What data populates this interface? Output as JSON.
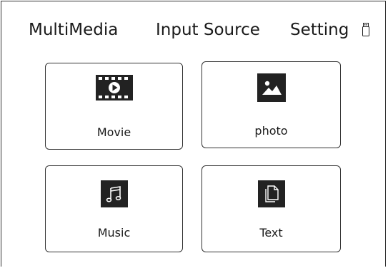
{
  "menu": {
    "multimedia": "MultiMedia",
    "input_source": "Input Source",
    "setting": "Setting"
  },
  "status": {
    "icon": "usb-drive-icon"
  },
  "tiles": [
    {
      "label": "Movie",
      "icon": "film-icon"
    },
    {
      "label": "photo",
      "icon": "image-icon"
    },
    {
      "label": "Music",
      "icon": "music-note-icon"
    },
    {
      "label": "Text",
      "icon": "document-icon"
    }
  ],
  "colors": {
    "icon_bg": "#222222",
    "border": "#333333",
    "text": "#1a1a1a"
  }
}
